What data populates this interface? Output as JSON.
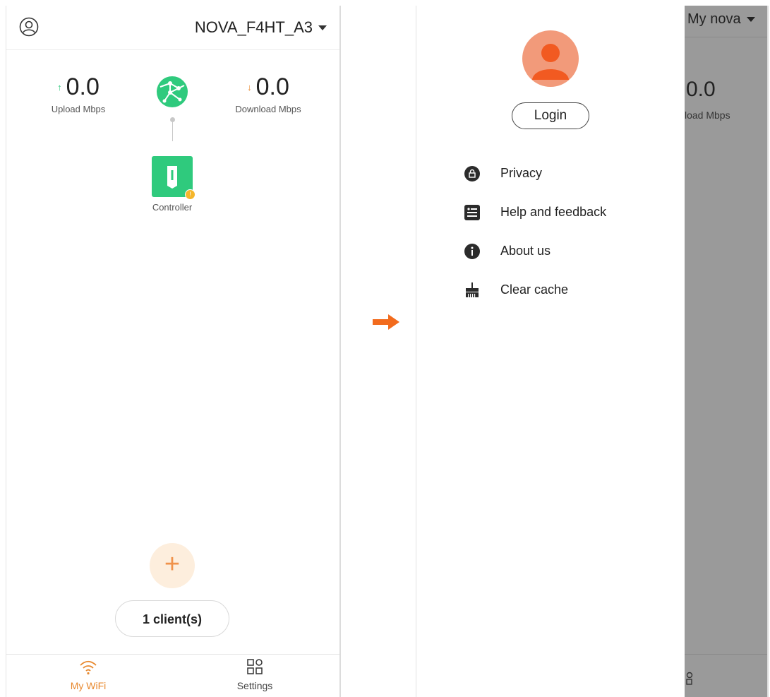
{
  "left": {
    "network_name": "NOVA_F4HT_A3",
    "upload": {
      "value": "0.0",
      "label": "Upload Mbps"
    },
    "download": {
      "value": "0.0",
      "label": "Download Mbps"
    },
    "controller_label": "Controller",
    "controller_badge": "!",
    "add_button": "+",
    "clients_label": "1 client(s)",
    "tabs": [
      {
        "label": "My WiFi",
        "icon": "wifi-icon",
        "active": true
      },
      {
        "label": "Settings",
        "icon": "grid-icon",
        "active": false
      }
    ],
    "accent": "#e8892f",
    "controller_color": "#2fca7d"
  },
  "right": {
    "login_label": "Login",
    "menu": [
      {
        "label": "Privacy",
        "icon": "lock-icon"
      },
      {
        "label": "Help and feedback",
        "icon": "feedback-list-icon"
      },
      {
        "label": "About us",
        "icon": "info-icon"
      },
      {
        "label": "Clear cache",
        "icon": "broom-icon"
      }
    ],
    "behind": {
      "title": "My nova",
      "value": "0.0",
      "label": "load Mbps"
    },
    "avatar_color": "#f29a7a"
  },
  "arrow_color": "#f26b1d"
}
